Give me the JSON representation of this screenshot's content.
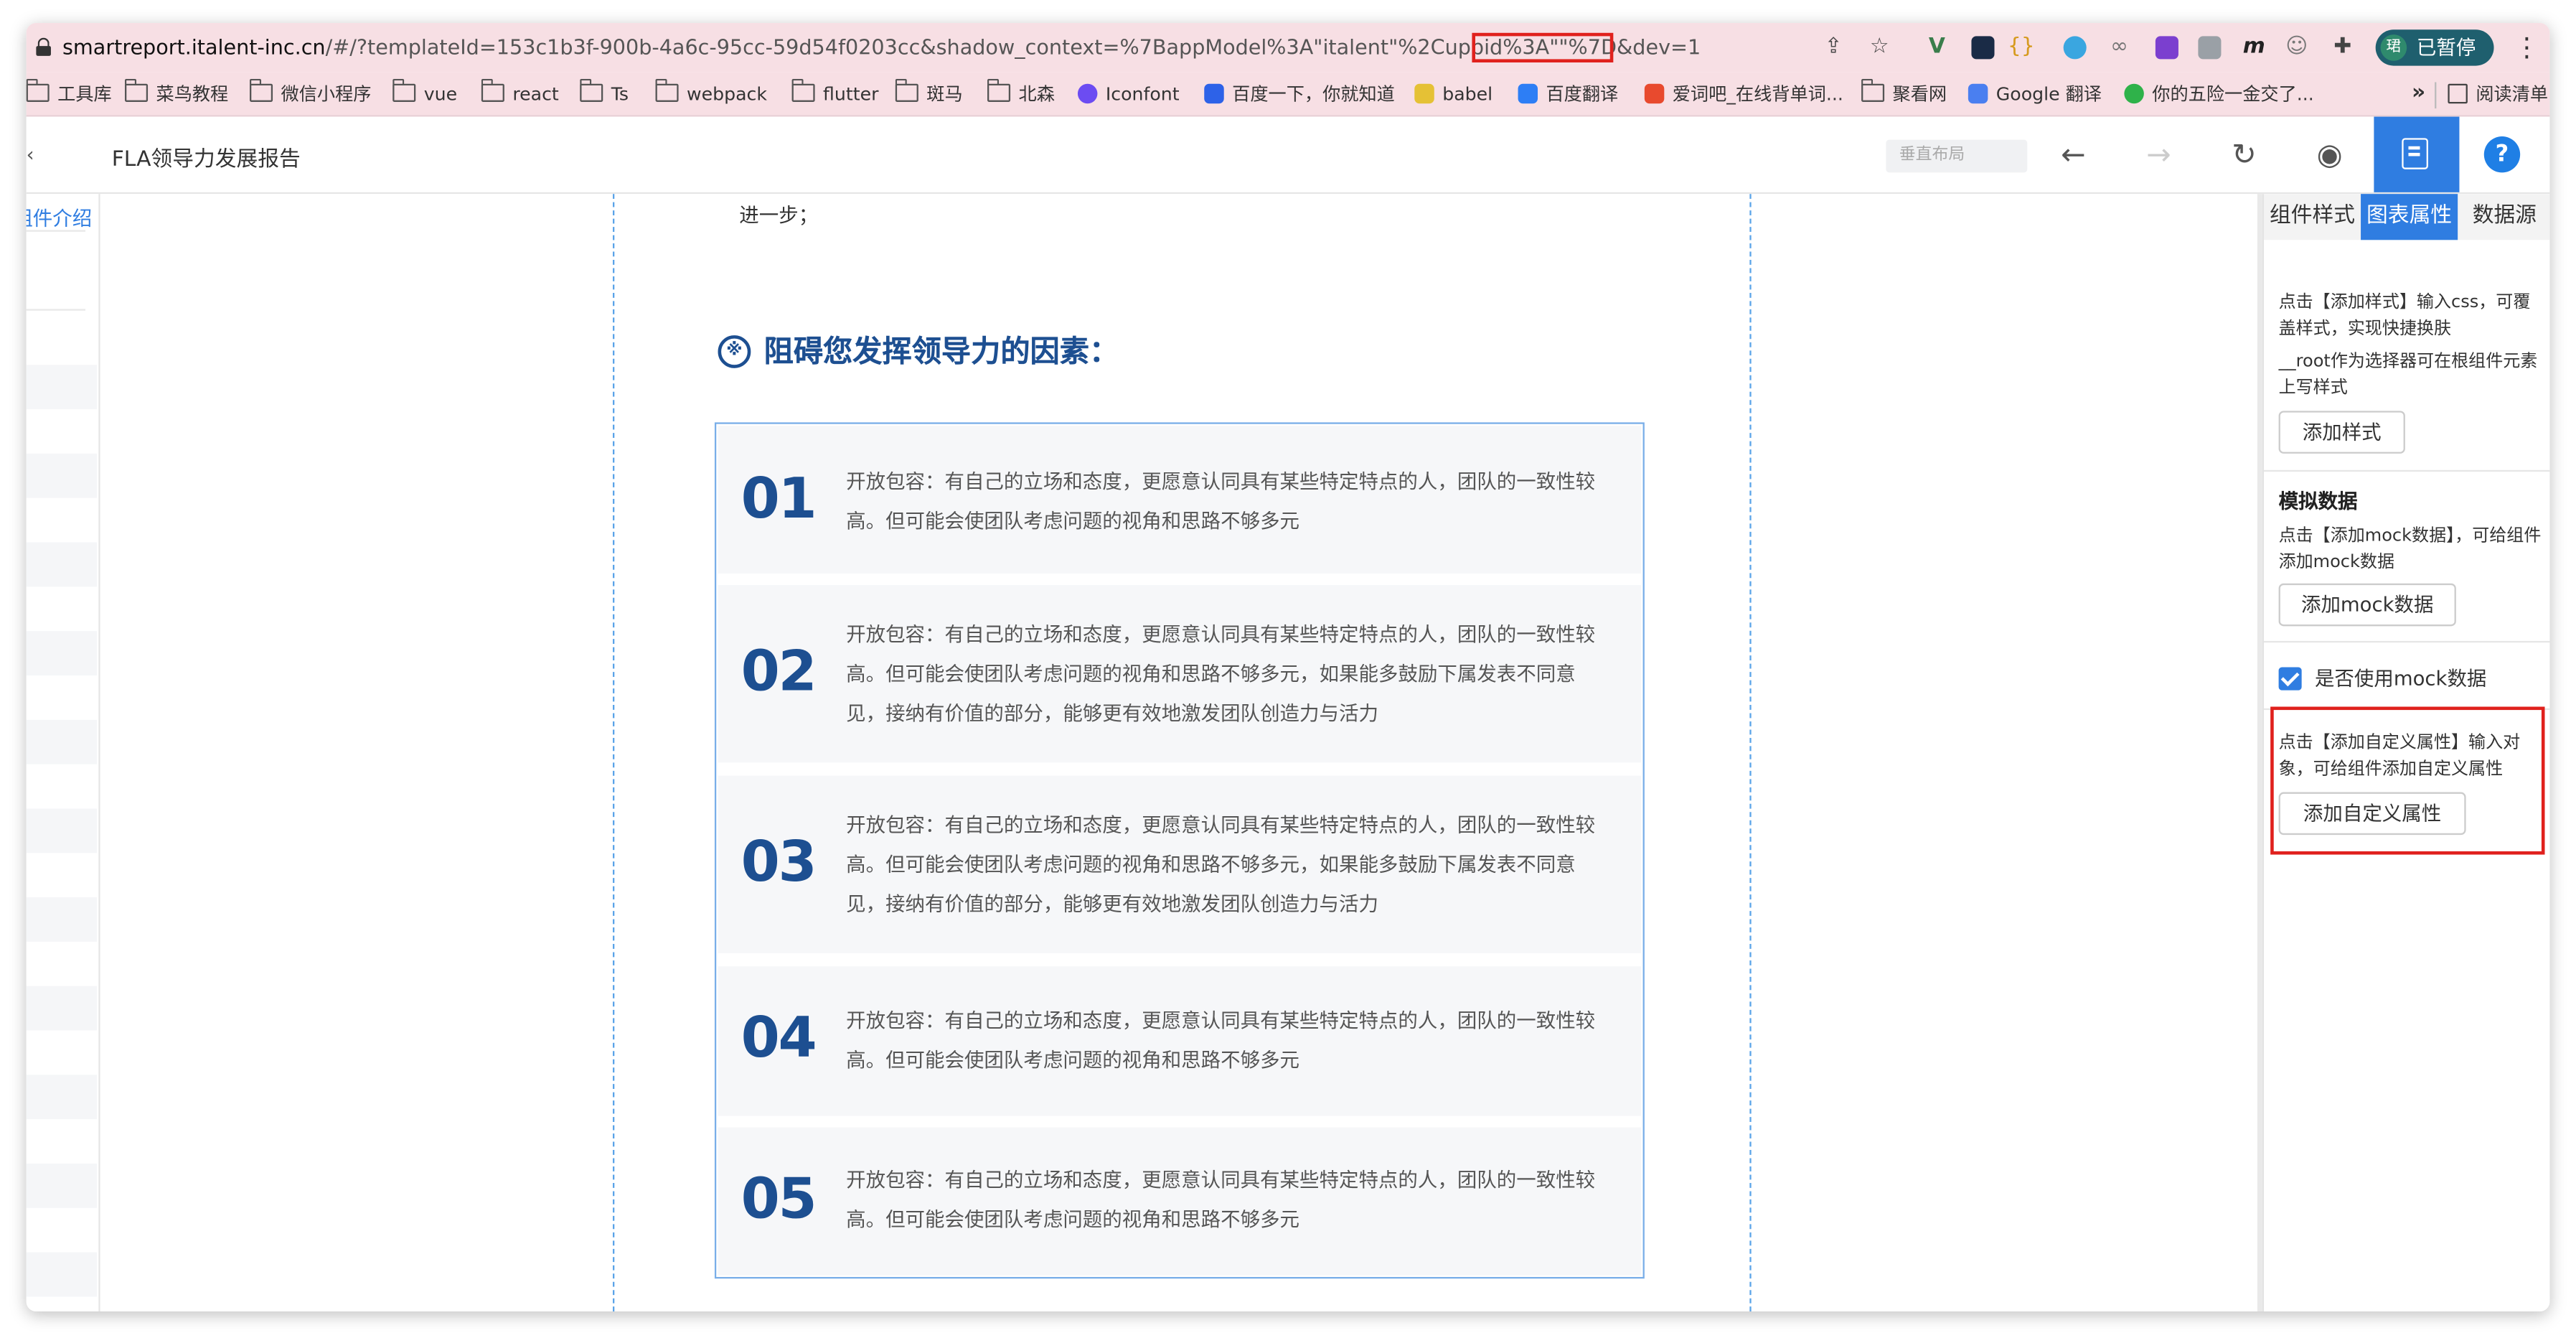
{
  "browser": {
    "url_host": "smartreport.italent-inc.cn",
    "url_path": "/#/?templateId=153c1b3f-900b-4a6c-95cc-59d54f0203cc&shadow_context=%7BappModel%3A\"italent\"%2Cuppid%3A\"\"",
    "url_highlighted": "%7D&dev=1",
    "profile_label": "已暂停",
    "profile_initial": "珺"
  },
  "bookmarks": [
    {
      "label": "工具库",
      "type": "folder"
    },
    {
      "label": "菜鸟教程",
      "type": "folder"
    },
    {
      "label": "微信小程序",
      "type": "folder"
    },
    {
      "label": "vue",
      "type": "folder"
    },
    {
      "label": "react",
      "type": "folder"
    },
    {
      "label": "Ts",
      "type": "folder"
    },
    {
      "label": "webpack",
      "type": "folder"
    },
    {
      "label": "flutter",
      "type": "folder"
    },
    {
      "label": "斑马",
      "type": "folder"
    },
    {
      "label": "北森",
      "type": "folder"
    },
    {
      "label": "Iconfont",
      "type": "site",
      "color": "#6c4cf2"
    },
    {
      "label": "百度一下，你就知道",
      "type": "site",
      "color": "#2d62e8"
    },
    {
      "label": "babel",
      "type": "site",
      "color": "#e5c135"
    },
    {
      "label": "百度翻译",
      "type": "site",
      "color": "#2d7ef5"
    },
    {
      "label": "爱词吧_在线背单词...",
      "type": "site",
      "color": "#e84a2e"
    },
    {
      "label": "聚看网",
      "type": "folder"
    },
    {
      "label": "Google 翻译",
      "type": "site",
      "color": "#4a7ff0"
    },
    {
      "label": "你的五险一金交了...",
      "type": "site",
      "color": "#2fb24a"
    },
    {
      "label": "阅读清单",
      "type": "reading"
    }
  ],
  "toolbar": {
    "back_label": "‹",
    "title": "FLA领导力发展报告",
    "layout_placeholder": "垂直布局",
    "help_label": "?"
  },
  "left_panel": {
    "label": "组件介绍"
  },
  "canvas": {
    "intro_text": "进一步；",
    "section_title": "阻碍您发挥领导力的因素：",
    "items": [
      {
        "number": "01",
        "text": "开放包容：有自己的立场和态度，更愿意认同具有某些特定特点的人，团队的一致性较高。但可能会使团队考虑问题的视角和思路不够多元"
      },
      {
        "number": "02",
        "text": "开放包容：有自己的立场和态度，更愿意认同具有某些特定特点的人，团队的一致性较高。但可能会使团队考虑问题的视角和思路不够多元，如果能多鼓励下属发表不同意见，接纳有价值的部分，能够更有效地激发团队创造力与活力"
      },
      {
        "number": "03",
        "text": "开放包容：有自己的立场和态度，更愿意认同具有某些特定特点的人，团队的一致性较高。但可能会使团队考虑问题的视角和思路不够多元，如果能多鼓励下属发表不同意见，接纳有价值的部分，能够更有效地激发团队创造力与活力"
      },
      {
        "number": "04",
        "text": "开放包容：有自己的立场和态度，更愿意认同具有某些特定特点的人，团队的一致性较高。但可能会使团队考虑问题的视角和思路不够多元"
      },
      {
        "number": "05",
        "text": "开放包容：有自己的立场和态度，更愿意认同具有某些特定特点的人，团队的一致性较高。但可能会使团队考虑问题的视角和思路不够多元"
      }
    ]
  },
  "right_panel": {
    "tabs": [
      "组件样式",
      "图表属性",
      "数据源"
    ],
    "active_tab": "图表属性",
    "style_hint": "点击【添加样式】输入css，可覆盖样式，实现快捷换肤",
    "root_hint": "__root作为选择器可在根组件元素上写样式",
    "add_style_label": "添加样式",
    "mock_title": "模拟数据",
    "mock_hint": "点击【添加mock数据】，可给组件添加mock数据",
    "add_mock_label": "添加mock数据",
    "use_mock_label": "是否使用mock数据",
    "use_mock_checked": true,
    "custom_hint": "点击【添加自定义属性】输入对象，可给组件添加自定义属性",
    "add_custom_label": "添加自定义属性"
  },
  "colors": {
    "accent": "#2f7de1",
    "title_blue": "#1d4f91",
    "annotation_red": "#e0211d"
  }
}
